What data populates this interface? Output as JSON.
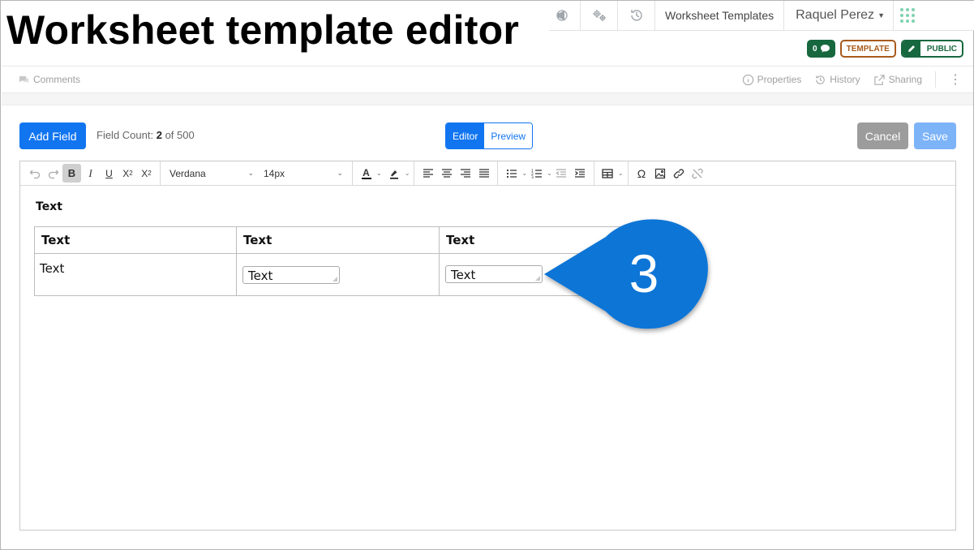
{
  "title": "Worksheet template editor",
  "topnav": {
    "icons": [
      "location-pin-icon",
      "announce-icon",
      "settings-gears-icon",
      "history-icon"
    ],
    "worksheet_templates": "Worksheet Templates",
    "user_name": "Raquel Perez",
    "apps_icon": "apps-grid-icon"
  },
  "badges": {
    "count": "0",
    "template": "TEMPLATE",
    "public": "PUBLIC"
  },
  "subbar": {
    "comments": "Comments",
    "properties": "Properties",
    "history": "History",
    "sharing": "Sharing"
  },
  "actions": {
    "add_field": "Add Field",
    "field_count_label": "Field Count:",
    "field_count_value": "2",
    "field_count_max": "of 500",
    "editor_tab": "Editor",
    "preview_tab": "Preview",
    "cancel": "Cancel",
    "save": "Save"
  },
  "toolbar": {
    "bold": "B",
    "italic": "I",
    "underline": "U",
    "font_family": "Verdana",
    "font_size": "14px"
  },
  "content": {
    "heading": "Text",
    "table": {
      "headers": [
        "Text",
        "Text",
        "Text"
      ],
      "row": {
        "cell_text": "Text",
        "input_1": "Text",
        "input_2": "Text"
      }
    }
  },
  "callout": {
    "number": "3",
    "color": "#0d74d6"
  }
}
